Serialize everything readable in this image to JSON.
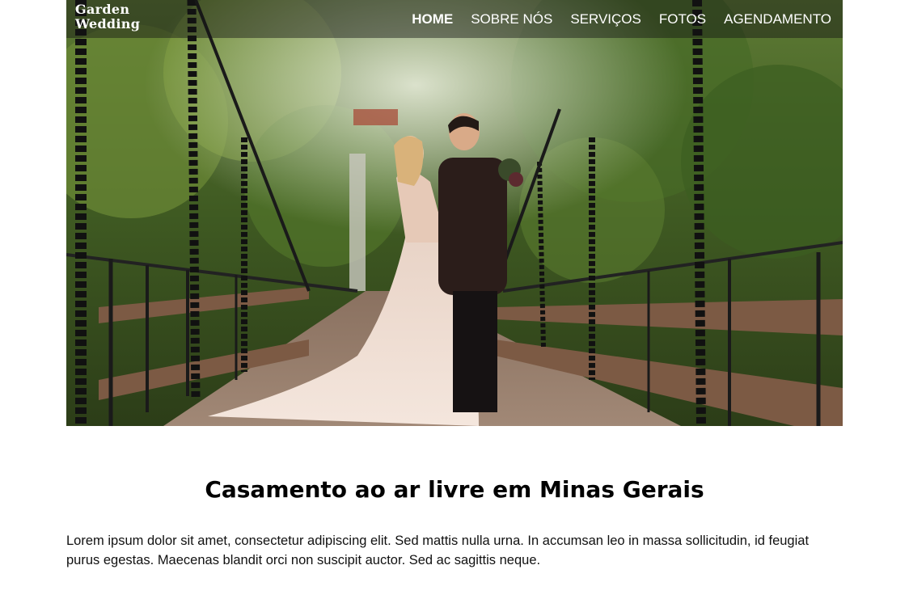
{
  "brand": {
    "line1": "Garden",
    "line2": "Wedding"
  },
  "nav": {
    "items": [
      {
        "label": "HOME",
        "active": true
      },
      {
        "label": "SOBRE NÓS",
        "active": false
      },
      {
        "label": "SERVIÇOS",
        "active": false
      },
      {
        "label": "FOTOS",
        "active": false
      },
      {
        "label": "AGENDAMENTO",
        "active": false
      }
    ]
  },
  "hero": {
    "image": "bride-and-groom-on-suspension-bridge-photo"
  },
  "content": {
    "title": "Casamento ao ar livre em Minas Gerais",
    "paragraph": "Lorem ipsum dolor sit amet, consectetur adipiscing elit. Sed mattis nulla urna. In accumsan leo in massa sollicitudin, id feugiat purus egestas. Maecenas blandit orci non suscipit auctor. Sed ac sagittis neque."
  },
  "colors": {
    "nav_bg": "#141414",
    "text": "#000000",
    "foliage": "#4a6b2a",
    "bridge_wood": "#7a5a40"
  }
}
